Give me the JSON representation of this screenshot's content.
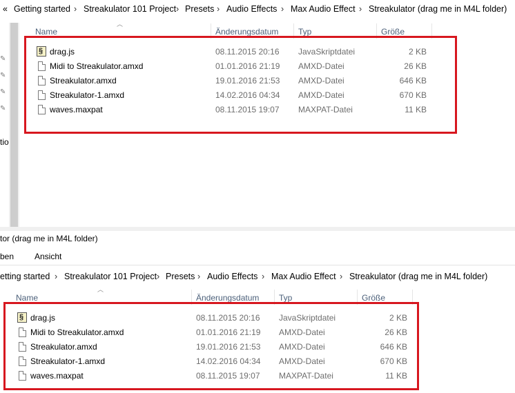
{
  "top": {
    "nav_back": "«",
    "breadcrumb": [
      "Getting started",
      "Streakulator 101 Project",
      "Presets",
      "Audio Effects",
      "Max Audio Effect",
      "Streakulator (drag me in M4L folder)"
    ],
    "separator": "›",
    "columns": {
      "name": "Name",
      "date": "Änderungsdatum",
      "type": "Typ",
      "size": "Größe"
    },
    "left_pane_text": "tio",
    "files": [
      {
        "name": "drag.js",
        "date": "08.11.2015 20:16",
        "type": "JavaSkriptdatei",
        "size": "2 KB",
        "icon": "javascript-file-icon"
      },
      {
        "name": "Midi to Streakulator.amxd",
        "date": "01.01.2016 21:19",
        "type": "AMXD-Datei",
        "size": "26 KB",
        "icon": "generic-file-icon"
      },
      {
        "name": "Streakulator.amxd",
        "date": "19.01.2016 21:53",
        "type": "AMXD-Datei",
        "size": "646 KB",
        "icon": "generic-file-icon"
      },
      {
        "name": "Streakulator-1.amxd",
        "date": "14.02.2016 04:34",
        "type": "AMXD-Datei",
        "size": "670 KB",
        "icon": "generic-file-icon"
      },
      {
        "name": "waves.maxpat",
        "date": "08.11.2015 19:07",
        "type": "MAXPAT-Datei",
        "size": "11 KB",
        "icon": "generic-file-icon"
      }
    ]
  },
  "bottom": {
    "window_title": "tor (drag me in M4L folder)",
    "ribbon": [
      "ben",
      "Ansicht"
    ],
    "breadcrumb": [
      "etting started",
      "Streakulator 101 Project",
      "Presets",
      "Audio Effects",
      "Max Audio Effect",
      "Streakulator (drag me in M4L folder)"
    ],
    "separator": "›",
    "columns": {
      "name": "Name",
      "date": "Änderungsdatum",
      "type": "Typ",
      "size": "Größe"
    },
    "files": [
      {
        "name": "drag.js",
        "date": "08.11.2015 20:16",
        "type": "JavaSkriptdatei",
        "size": "2 KB",
        "icon": "javascript-file-icon"
      },
      {
        "name": "Midi to Streakulator.amxd",
        "date": "01.01.2016 21:19",
        "type": "AMXD-Datei",
        "size": "26 KB",
        "icon": "generic-file-icon"
      },
      {
        "name": "Streakulator.amxd",
        "date": "19.01.2016 21:53",
        "type": "AMXD-Datei",
        "size": "646 KB",
        "icon": "generic-file-icon"
      },
      {
        "name": "Streakulator-1.amxd",
        "date": "14.02.2016 04:34",
        "type": "AMXD-Datei",
        "size": "670 KB",
        "icon": "generic-file-icon"
      },
      {
        "name": "waves.maxpat",
        "date": "08.11.2015 19:07",
        "type": "MAXPAT-Datei",
        "size": "11 KB",
        "icon": "generic-file-icon"
      }
    ]
  },
  "colors": {
    "highlight": "#d7171f",
    "header_text": "#4c607a",
    "meta_text": "#6d6d6d"
  }
}
